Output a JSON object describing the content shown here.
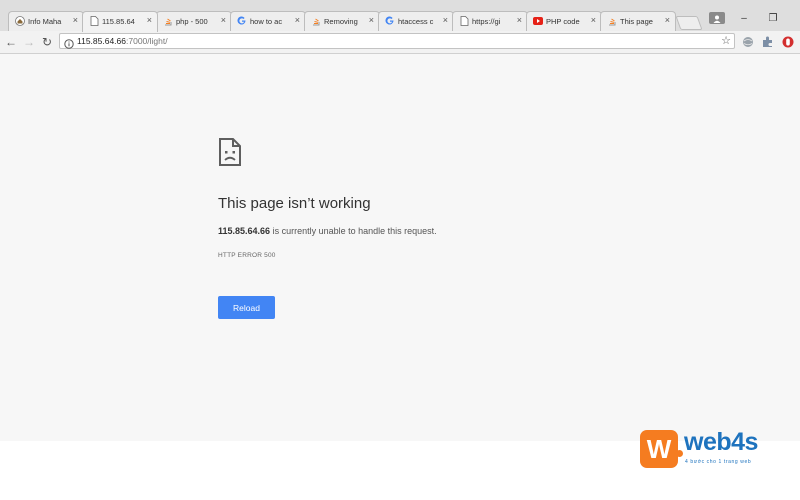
{
  "browser": {
    "tabs": [
      {
        "title": "Info Maha",
        "icon": "home-icon"
      },
      {
        "title": "115.85.64",
        "icon": "page-icon",
        "active": true
      },
      {
        "title": "php - 500",
        "icon": "stackoverflow-icon"
      },
      {
        "title": "how to ac",
        "icon": "google-icon"
      },
      {
        "title": "Removing",
        "icon": "stackoverflow-icon"
      },
      {
        "title": "htaccess c",
        "icon": "google-icon"
      },
      {
        "title": "https://gi",
        "icon": "page-icon"
      },
      {
        "title": "PHP code",
        "icon": "youtube-icon"
      },
      {
        "title": "This page",
        "icon": "stackoverflow-icon"
      }
    ],
    "close_glyph": "×",
    "window_controls": {
      "minimize": "–",
      "restore": "❐"
    },
    "toolbar": {
      "back": "←",
      "forward": "→",
      "reload": "↻",
      "url_host": "115.85.64.66",
      "url_rest": ":7000/light/",
      "star": "☆"
    }
  },
  "page": {
    "heading": "This page isn’t working",
    "description_host": "115.85.64.66",
    "description_rest": " is currently unable to handle this request.",
    "error_code": "HTTP ERROR 500",
    "reload_label": "Reload"
  },
  "watermark": {
    "badge_letter": "W",
    "name": "web4s",
    "tagline": "4 bước cho 1 trang web"
  },
  "colors": {
    "reload_button": "#4285f4",
    "page_background": "#f7f7f7",
    "watermark_orange": "#f57c20",
    "watermark_blue": "#1e73be"
  }
}
